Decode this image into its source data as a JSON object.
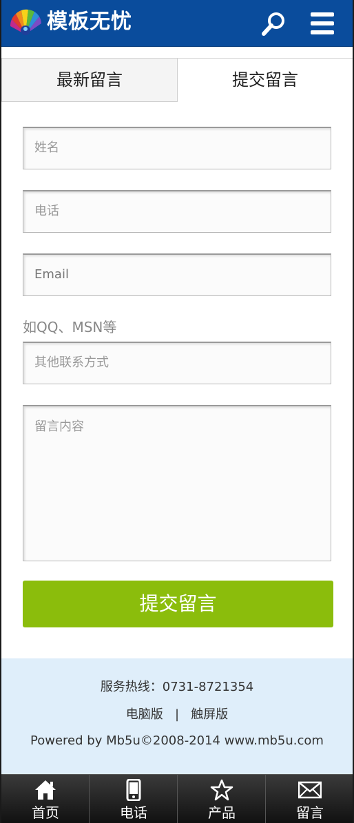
{
  "header": {
    "logo_text": "模板无忧",
    "search_icon": "search-icon",
    "menu_icon": "menu-icon",
    "background": "#0a4c9c"
  },
  "tabs": [
    {
      "label": "最新留言",
      "active": false
    },
    {
      "label": "提交留言",
      "active": true
    }
  ],
  "form": {
    "name_placeholder": "姓名",
    "phone_placeholder": "电话",
    "email_placeholder": "Email",
    "contact_hint": "如QQ、MSN等",
    "contact_placeholder": "其他联系方式",
    "message_placeholder": "留言内容",
    "submit_label": "提交留言",
    "submit_color": "#8bbd0c"
  },
  "footer": {
    "hotline": "服务热线：0731-8721354",
    "desktop_link": "电脑版",
    "separator": "|",
    "touch_link": "触屏版",
    "powered": "Powered by Mb5u©2008-2014  www.mb5u.com",
    "background": "#dfeefa"
  },
  "bottom_nav": [
    {
      "label": "首页",
      "icon": "home-icon"
    },
    {
      "label": "电话",
      "icon": "phone-icon"
    },
    {
      "label": "产品",
      "icon": "star-icon"
    },
    {
      "label": "留言",
      "icon": "mail-icon"
    }
  ]
}
